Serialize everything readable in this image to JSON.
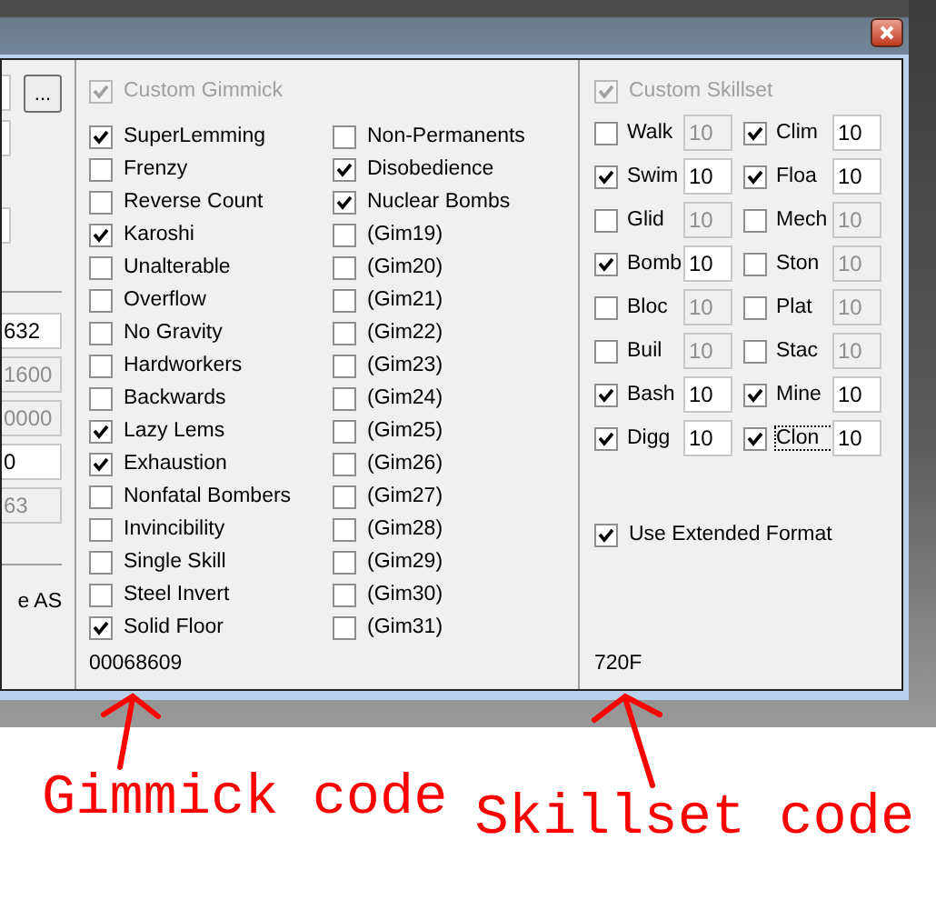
{
  "left_panel": {
    "browse_button": "...",
    "fields": [
      {
        "value": "632",
        "disabled": false
      },
      {
        "value": "1600",
        "disabled": true
      },
      {
        "value": "0000",
        "disabled": true
      },
      {
        "value": "0",
        "disabled": false
      },
      {
        "value": "63",
        "disabled": true
      }
    ],
    "label": "e AS"
  },
  "gimmick_panel": {
    "custom": {
      "label": "Custom Gimmick",
      "checked": true,
      "disabled": true
    },
    "items": [
      {
        "label": "SuperLemming",
        "checked": true
      },
      {
        "label": "Frenzy",
        "checked": false
      },
      {
        "label": "Reverse Count",
        "checked": false
      },
      {
        "label": "Karoshi",
        "checked": true
      },
      {
        "label": "Unalterable",
        "checked": false
      },
      {
        "label": "Overflow",
        "checked": false
      },
      {
        "label": "No Gravity",
        "checked": false
      },
      {
        "label": "Hardworkers",
        "checked": false
      },
      {
        "label": "Backwards",
        "checked": false
      },
      {
        "label": "Lazy Lems",
        "checked": true
      },
      {
        "label": "Exhaustion",
        "checked": true
      },
      {
        "label": "Nonfatal Bombers",
        "checked": false
      },
      {
        "label": "Invincibility",
        "checked": false
      },
      {
        "label": "Single Skill",
        "checked": false
      },
      {
        "label": "Steel Invert",
        "checked": false
      },
      {
        "label": "Solid Floor",
        "checked": true
      },
      {
        "label": "Non-Permanents",
        "checked": false
      },
      {
        "label": "Disobedience",
        "checked": true
      },
      {
        "label": "Nuclear Bombs",
        "checked": true
      },
      {
        "label": "(Gim19)",
        "checked": false
      },
      {
        "label": "(Gim20)",
        "checked": false
      },
      {
        "label": "(Gim21)",
        "checked": false
      },
      {
        "label": "(Gim22)",
        "checked": false
      },
      {
        "label": "(Gim23)",
        "checked": false
      },
      {
        "label": "(Gim24)",
        "checked": false
      },
      {
        "label": "(Gim25)",
        "checked": false
      },
      {
        "label": "(Gim26)",
        "checked": false
      },
      {
        "label": "(Gim27)",
        "checked": false
      },
      {
        "label": "(Gim28)",
        "checked": false
      },
      {
        "label": "(Gim29)",
        "checked": false
      },
      {
        "label": "(Gim30)",
        "checked": false
      },
      {
        "label": "(Gim31)",
        "checked": false
      }
    ],
    "code": "00068609"
  },
  "skillset_panel": {
    "custom": {
      "label": "Custom Skillset",
      "checked": true,
      "disabled": true
    },
    "skills": [
      {
        "label": "Walk",
        "checked": false,
        "focused": false,
        "value": "10"
      },
      {
        "label": "Clim",
        "checked": true,
        "focused": false,
        "value": "10"
      },
      {
        "label": "Swim",
        "checked": true,
        "focused": false,
        "value": "10"
      },
      {
        "label": "Floa",
        "checked": true,
        "focused": false,
        "value": "10"
      },
      {
        "label": "Glid",
        "checked": false,
        "focused": false,
        "value": "10"
      },
      {
        "label": "Mech",
        "checked": false,
        "focused": false,
        "value": "10"
      },
      {
        "label": "Bomb",
        "checked": true,
        "focused": false,
        "value": "10"
      },
      {
        "label": "Ston",
        "checked": false,
        "focused": false,
        "value": "10"
      },
      {
        "label": "Bloc",
        "checked": false,
        "focused": false,
        "value": "10"
      },
      {
        "label": "Plat",
        "checked": false,
        "focused": false,
        "value": "10"
      },
      {
        "label": "Buil",
        "checked": false,
        "focused": false,
        "value": "10"
      },
      {
        "label": "Stac",
        "checked": false,
        "focused": false,
        "value": "10"
      },
      {
        "label": "Bash",
        "checked": true,
        "focused": false,
        "value": "10"
      },
      {
        "label": "Mine",
        "checked": true,
        "focused": false,
        "value": "10"
      },
      {
        "label": "Digg",
        "checked": true,
        "focused": false,
        "value": "10"
      },
      {
        "label": "Clon",
        "checked": true,
        "focused": true,
        "value": "10"
      }
    ],
    "extended": {
      "label": "Use Extended Format",
      "checked": true
    },
    "code": "720F"
  },
  "annotations": [
    {
      "text": "Gimmick code"
    },
    {
      "text": "Skillset code"
    }
  ]
}
